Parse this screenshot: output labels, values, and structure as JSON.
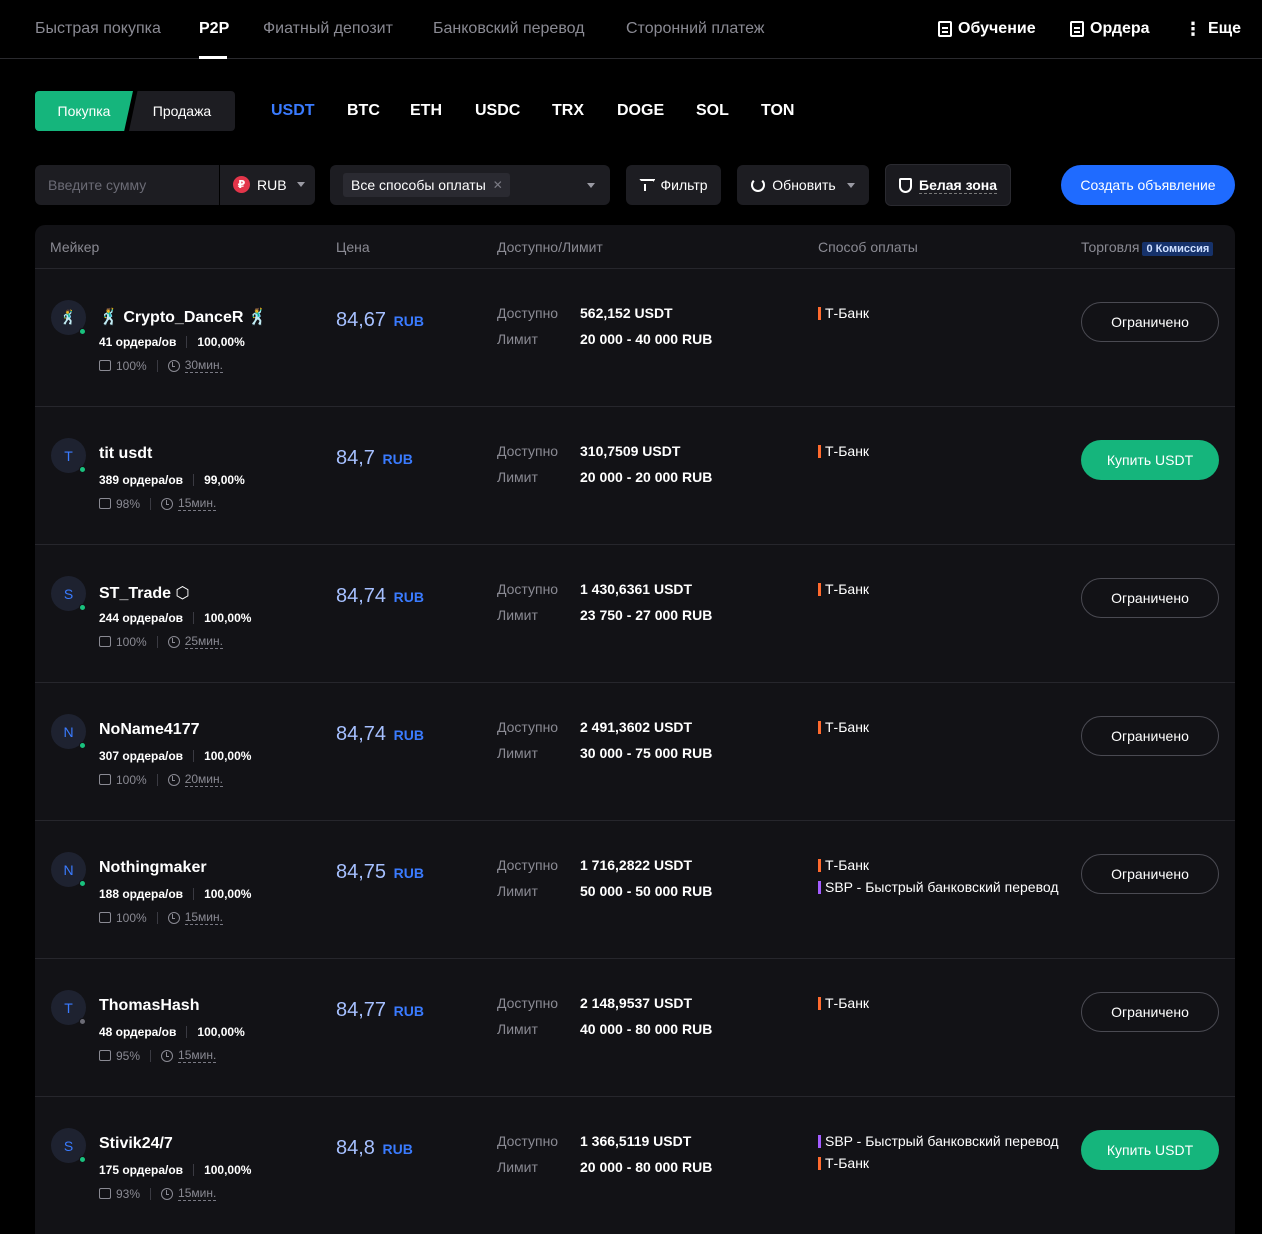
{
  "nav": {
    "tabs": [
      "Быстрая покупка",
      "P2P",
      "Фиатный депозит",
      "Банковский перевод",
      "Сторонний платеж"
    ],
    "active_tab": "P2P",
    "learning": "Обучение",
    "orders": "Ордера",
    "more": "Еще"
  },
  "side": {
    "buy": "Покупка",
    "sell": "Продажа"
  },
  "coins": [
    "USDT",
    "BTC",
    "ETH",
    "USDC",
    "TRX",
    "DOGE",
    "SOL",
    "TON"
  ],
  "active_coin": "USDT",
  "filters": {
    "amount_placeholder": "Введите сумму",
    "currency": "RUB",
    "currency_symbol": "₽",
    "payment_chip": "Все способы оплаты",
    "filter": "Фильтр",
    "refresh": "Обновить",
    "white_zone": "Белая зона",
    "create_ad": "Создать объявление"
  },
  "table": {
    "headers": {
      "maker": "Мейкер",
      "price": "Цена",
      "available": "Доступно/Лимит",
      "payment": "Способ оплаты",
      "trade": "Торговля",
      "commission": "0 Комиссия"
    },
    "label_available": "Доступно",
    "label_limit": "Лимит",
    "rows": [
      {
        "initial": "🕺",
        "name": "🕺 Crypto_DanceR 🕺",
        "online": true,
        "orders": "41 ордера/ов",
        "completion": "100,00%",
        "likes": "100%",
        "time": "30мин.",
        "price": "84,67",
        "unit": "RUB",
        "available": "562,152 USDT",
        "limit": "20 000 - 40 000 RUB",
        "payments": [
          {
            "name": "Т-Банк",
            "color": "#ff6a2e"
          }
        ],
        "action": "Ограничено",
        "action_type": "limited"
      },
      {
        "initial": "T",
        "name": "tit usdt",
        "online": true,
        "orders": "389 ордера/ов",
        "completion": "99,00%",
        "likes": "98%",
        "time": "15мин.",
        "price": "84,7",
        "unit": "RUB",
        "available": "310,7509 USDT",
        "limit": "20 000 - 20 000 RUB",
        "payments": [
          {
            "name": "Т-Банк",
            "color": "#ff6a2e"
          }
        ],
        "action": "Купить USDT",
        "action_type": "buy"
      },
      {
        "initial": "S",
        "name": "ST_Trade ⬡",
        "online": true,
        "orders": "244 ордера/ов",
        "completion": "100,00%",
        "likes": "100%",
        "time": "25мин.",
        "price": "84,74",
        "unit": "RUB",
        "available": "1 430,6361 USDT",
        "limit": "23 750 - 27 000 RUB",
        "payments": [
          {
            "name": "Т-Банк",
            "color": "#ff6a2e"
          }
        ],
        "action": "Ограничено",
        "action_type": "limited"
      },
      {
        "initial": "N",
        "name": "NoName4177",
        "online": true,
        "orders": "307 ордера/ов",
        "completion": "100,00%",
        "likes": "100%",
        "time": "20мин.",
        "price": "84,74",
        "unit": "RUB",
        "available": "2 491,3602 USDT",
        "limit": "30 000 - 75 000 RUB",
        "payments": [
          {
            "name": "Т-Банк",
            "color": "#ff6a2e"
          }
        ],
        "action": "Ограничено",
        "action_type": "limited"
      },
      {
        "initial": "N",
        "name": "Nothingmaker",
        "online": true,
        "orders": "188 ордера/ов",
        "completion": "100,00%",
        "likes": "100%",
        "time": "15мин.",
        "price": "84,75",
        "unit": "RUB",
        "available": "1 716,2822 USDT",
        "limit": "50 000 - 50 000 RUB",
        "payments": [
          {
            "name": "Т-Банк",
            "color": "#ff6a2e"
          },
          {
            "name": "SBP - Быстрый банковский перевод",
            "color": "#a45cff"
          }
        ],
        "action": "Ограничено",
        "action_type": "limited"
      },
      {
        "initial": "T",
        "name": "ThomasHash",
        "online": false,
        "orders": "48 ордера/ов",
        "completion": "100,00%",
        "likes": "95%",
        "time": "15мин.",
        "price": "84,77",
        "unit": "RUB",
        "available": "2 148,9537 USDT",
        "limit": "40 000 - 80 000 RUB",
        "payments": [
          {
            "name": "Т-Банк",
            "color": "#ff6a2e"
          }
        ],
        "action": "Ограничено",
        "action_type": "limited"
      },
      {
        "initial": "S",
        "name": "Stivik24/7",
        "online": true,
        "orders": "175 ордера/ов",
        "completion": "100,00%",
        "likes": "93%",
        "time": "15мин.",
        "price": "84,8",
        "unit": "RUB",
        "available": "1 366,5119 USDT",
        "limit": "20 000 - 80 000 RUB",
        "payments": [
          {
            "name": "SBP - Быстрый банковский перевод",
            "color": "#a45cff"
          },
          {
            "name": "Т-Банк",
            "color": "#ff6a2e"
          }
        ],
        "action": "Купить USDT",
        "action_type": "buy"
      }
    ]
  }
}
